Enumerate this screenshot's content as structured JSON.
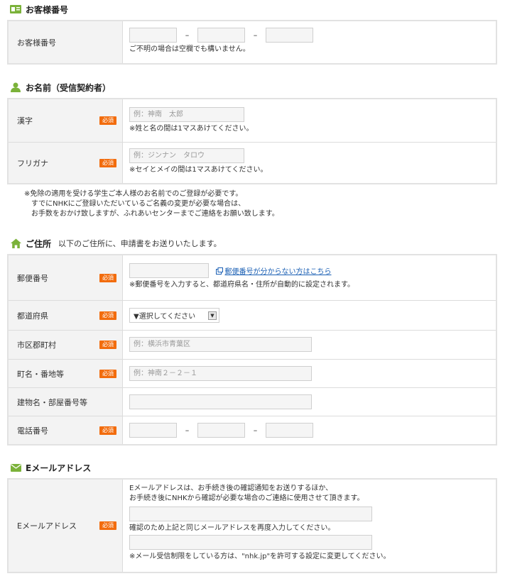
{
  "customer": {
    "title": "お客様番号",
    "label": "お客様番号",
    "note": "ご不明の場合は空欄でも構いません。"
  },
  "name": {
    "title": "お名前（受信契約者）",
    "kanji_label": "漢字",
    "kanji_placeholder": "例：神南　太郎",
    "kanji_note": "※姓と名の間は1マスあけてください。",
    "kana_label": "フリガナ",
    "kana_placeholder": "例：ジンナン　タロウ",
    "kana_note": "※セイとメイの間は1マスあけてください。",
    "notice": [
      "※免除の適用を受ける学生ご本人様のお名前でのご登録が必要です。",
      "すでにNHKにご登録いただいているご名義の変更が必要な場合は、",
      "お手数をおかけ致しますが、ふれあいセンターまでご連絡をお願い致します。"
    ]
  },
  "address": {
    "title": "ご住所",
    "subtitle": "以下のご住所に、申請書をお送りいたします。",
    "postal_label": "郵便番号",
    "postal_link": "郵便番号が分からない方はこちら",
    "postal_note": "※郵便番号を入力すると、都道府県名・住所が自動的に設定されます。",
    "pref_label": "都道府県",
    "pref_selected": "▼選択してください",
    "city_label": "市区郡町村",
    "city_placeholder": "例：横浜市青葉区",
    "town_label": "町名・番地等",
    "town_placeholder": "例：神南２－２－１",
    "building_label": "建物名・部屋番号等",
    "phone_label": "電話番号"
  },
  "email": {
    "title": "Eメールアドレス",
    "label": "Eメールアドレス",
    "intro_1": "Eメールアドレスは、お手続き後の確認通知をお送りするほか、",
    "intro_2": "お手続き後にNHKから確認が必要な場合のご連絡に使用させて頂きます。",
    "confirm_note": "確認のため上記と同じメールアドレスを再度入力してください。",
    "restrict_note": "※メール受信制限をしている方は、\"nhk.jp\"を許可する設定に変更してください。"
  },
  "common": {
    "required_badge": "必須",
    "dash": "–"
  },
  "colors": {
    "accent_green": "#7bb23a",
    "badge_orange": "#f26c0d",
    "link_blue": "#1a5fb4"
  },
  "icons": {
    "customer": "id-card-icon",
    "name": "person-icon",
    "address": "house-icon",
    "email": "envelope-icon",
    "link": "external-link-icon",
    "select": "chevron-down-icon"
  }
}
